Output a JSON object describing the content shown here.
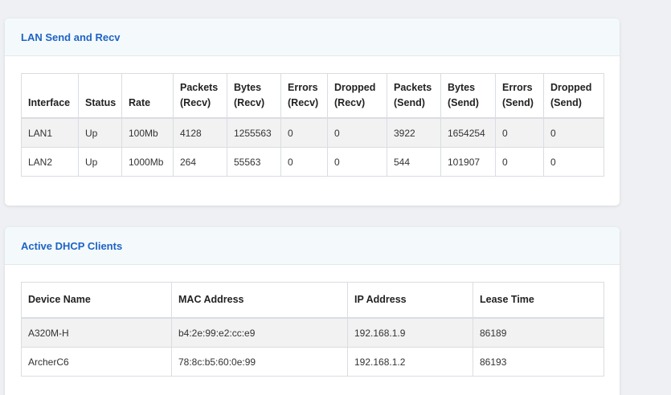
{
  "lan": {
    "title": "LAN Send and Recv",
    "headers": [
      [
        "Interface"
      ],
      [
        "Status"
      ],
      [
        "Rate"
      ],
      [
        "Packets",
        "(Recv)"
      ],
      [
        "Bytes",
        "(Recv)"
      ],
      [
        "Errors",
        "(Recv)"
      ],
      [
        "Dropped",
        "(Recv)"
      ],
      [
        "Packets",
        "(Send)"
      ],
      [
        "Bytes",
        "(Send)"
      ],
      [
        "Errors",
        "(Send)"
      ],
      [
        "Dropped",
        "(Send)"
      ]
    ],
    "rows": [
      [
        "LAN1",
        "Up",
        "100Mb",
        "4128",
        "1255563",
        "0",
        "0",
        "3922",
        "1654254",
        "0",
        "0"
      ],
      [
        "LAN2",
        "Up",
        "1000Mb",
        "264",
        "55563",
        "0",
        "0",
        "544",
        "101907",
        "0",
        "0"
      ]
    ]
  },
  "dhcp": {
    "title": "Active DHCP Clients",
    "headers": [
      "Device Name",
      "MAC Address",
      "IP Address",
      "Lease Time"
    ],
    "rows": [
      [
        "A320M-H",
        "b4:2e:99:e2:cc:e9",
        "192.168.1.9",
        "86189"
      ],
      [
        "ArcherC6",
        "78:8c:b5:60:0e:99",
        "192.168.1.2",
        "86193"
      ]
    ]
  },
  "colors": {
    "accent": "#1f63c6",
    "header_bg": "#f4fafb",
    "striped_row": "#f2f2f2",
    "page_bg": "#eef0f3"
  }
}
